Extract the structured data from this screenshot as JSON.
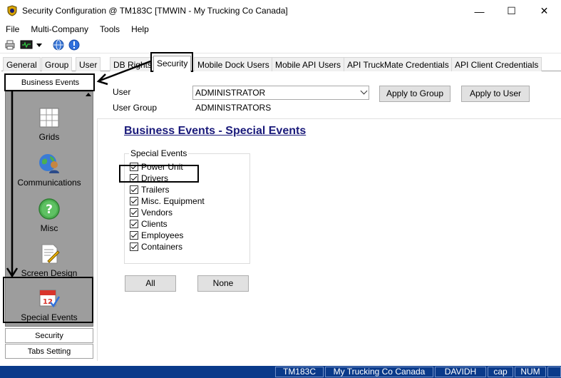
{
  "window": {
    "title": "Security Configuration @ TM183C [TMWIN - My Trucking Co Canada]",
    "minimize": "—",
    "maximize": "☐",
    "close": "✕"
  },
  "menu": [
    "File",
    "Multi-Company",
    "Tools",
    "Help"
  ],
  "toolbar": {
    "icons": [
      "print-icon",
      "monitor-icon",
      "dropdown-icon",
      "globe-icon",
      "info-icon"
    ]
  },
  "tabs": [
    {
      "label": "General",
      "active": false
    },
    {
      "label": "Group",
      "active": false
    },
    {
      "label": "User",
      "active": false
    },
    {
      "label": "DB Rights",
      "active": false
    },
    {
      "label": "Security",
      "active": true
    },
    {
      "label": "Mobile Dock Users",
      "active": false
    },
    {
      "label": "Mobile API Users",
      "active": false
    },
    {
      "label": "API TruckMate Credentials",
      "active": false
    },
    {
      "label": "API Client Credentials",
      "active": false
    }
  ],
  "sidebar": {
    "header": "Business Events",
    "items": [
      {
        "label": "Grids",
        "icon": "grid-icon"
      },
      {
        "label": "Communications",
        "icon": "communications-icon"
      },
      {
        "label": "Misc",
        "icon": "help-icon"
      },
      {
        "label": "Screen Design",
        "icon": "screen-design-icon"
      },
      {
        "label": "Special Events",
        "icon": "calendar-icon"
      }
    ],
    "bottom_buttons": [
      "Security",
      "Tabs Setting"
    ]
  },
  "form": {
    "user_label": "User",
    "user_value": "ADMINISTRATOR",
    "group_label": "User Group",
    "group_value": "ADMINISTRATORS",
    "apply_group": "Apply to Group",
    "apply_user": "Apply to User"
  },
  "section": {
    "title": "Business Events - Special Events",
    "group_title": "Special Events",
    "checkboxes": [
      {
        "label": "Power Unit",
        "checked": true
      },
      {
        "label": "Drivers",
        "checked": true
      },
      {
        "label": "Trailers",
        "checked": true
      },
      {
        "label": "Misc. Equipment",
        "checked": true
      },
      {
        "label": "Vendors",
        "checked": true
      },
      {
        "label": "Clients",
        "checked": true
      },
      {
        "label": "Employees",
        "checked": true
      },
      {
        "label": "Containers",
        "checked": true
      }
    ],
    "all_button": "All",
    "none_button": "None"
  },
  "status": [
    "TM183C",
    "My Trucking Co Canada",
    "DAVIDH",
    "cap",
    "NUM"
  ],
  "colors": {
    "status_bg": "#0a3a8a",
    "sidebar_bg": "#9d9d9d",
    "title_link": "#1a1a7a"
  }
}
